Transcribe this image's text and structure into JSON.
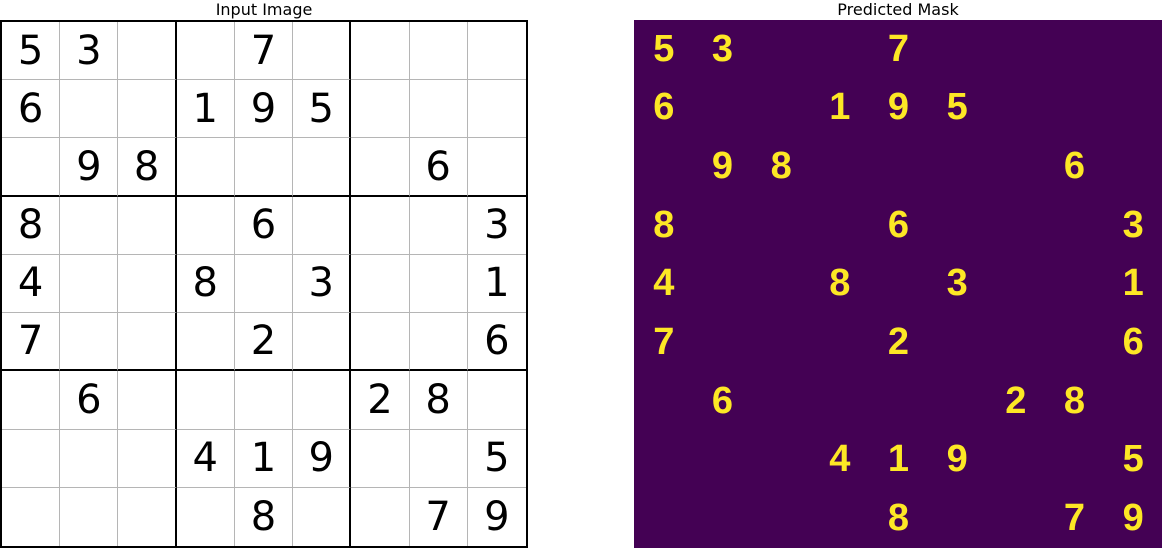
{
  "titles": {
    "left": "Input Image",
    "right": "Predicted Mask"
  },
  "chart_data": [
    {
      "type": "table",
      "title": "Input Image",
      "description": "9x9 sudoku grid with given digits (null = empty cell)",
      "grid": [
        [
          5,
          3,
          null,
          null,
          7,
          null,
          null,
          null,
          null
        ],
        [
          6,
          null,
          null,
          1,
          9,
          5,
          null,
          null,
          null
        ],
        [
          null,
          9,
          8,
          null,
          null,
          null,
          null,
          6,
          null
        ],
        [
          8,
          null,
          null,
          null,
          6,
          null,
          null,
          null,
          3
        ],
        [
          4,
          null,
          null,
          8,
          null,
          3,
          null,
          null,
          1
        ],
        [
          7,
          null,
          null,
          null,
          2,
          null,
          null,
          null,
          6
        ],
        [
          null,
          6,
          null,
          null,
          null,
          null,
          2,
          8,
          null
        ],
        [
          null,
          null,
          null,
          4,
          1,
          9,
          null,
          null,
          5
        ],
        [
          null,
          null,
          null,
          null,
          8,
          null,
          null,
          7,
          9
        ]
      ]
    },
    {
      "type": "heatmap",
      "title": "Predicted Mask",
      "description": "Segmentation mask over same 9x9 layout; background purple, detected digits yellow. Same digit positions as input.",
      "colormap": "viridis",
      "background_color": "#440154",
      "digit_color": "#FDE725",
      "grid": [
        [
          5,
          3,
          null,
          null,
          7,
          null,
          null,
          null,
          null
        ],
        [
          6,
          null,
          null,
          1,
          9,
          5,
          null,
          null,
          null
        ],
        [
          null,
          9,
          8,
          null,
          null,
          null,
          null,
          6,
          null
        ],
        [
          8,
          null,
          null,
          null,
          6,
          null,
          null,
          null,
          3
        ],
        [
          4,
          null,
          null,
          8,
          null,
          3,
          null,
          null,
          1
        ],
        [
          7,
          null,
          null,
          null,
          2,
          null,
          null,
          null,
          6
        ],
        [
          null,
          6,
          null,
          null,
          null,
          null,
          2,
          8,
          null
        ],
        [
          null,
          null,
          null,
          4,
          1,
          9,
          null,
          null,
          5
        ],
        [
          null,
          null,
          null,
          null,
          8,
          null,
          null,
          7,
          9
        ]
      ]
    }
  ]
}
